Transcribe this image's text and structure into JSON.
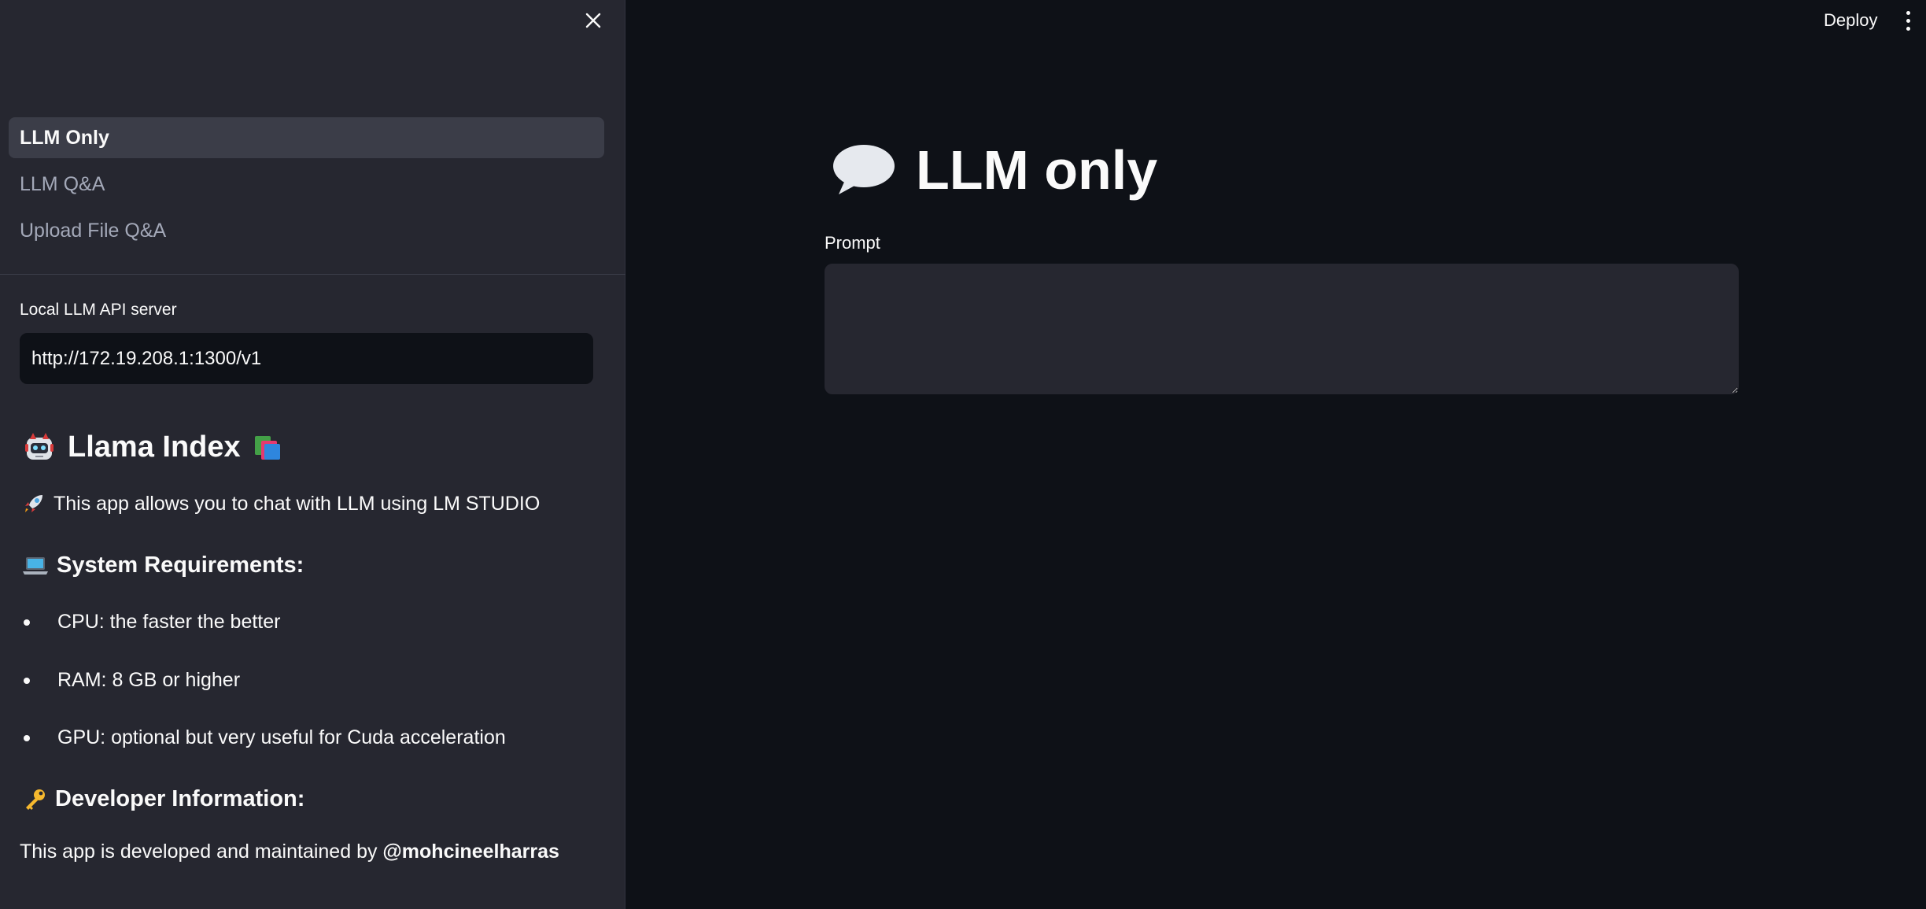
{
  "header": {
    "deploy_label": "Deploy"
  },
  "sidebar": {
    "nav": [
      {
        "label": "LLM Only",
        "active": true
      },
      {
        "label": "LLM Q&A",
        "active": false
      },
      {
        "label": "Upload File Q&A",
        "active": false
      }
    ],
    "server_field": {
      "label": "Local LLM API server",
      "value": "http://172.19.208.1:1300/v1"
    },
    "heading": "Llama Index",
    "description": "This app allows you to chat with LLM using LM STUDIO",
    "requirements_heading": "System Requirements:",
    "requirements": [
      "CPU: the faster the better",
      "RAM: 8 GB or higher",
      "GPU: optional but very useful for Cuda acceleration"
    ],
    "developer_heading": "Developer Information:",
    "developer_text": "This app is developed and maintained by",
    "developer_handle": "@mohcineelharras"
  },
  "main": {
    "title": "LLM only",
    "prompt_label": "Prompt",
    "prompt_value": ""
  },
  "colors": {
    "background": "#0e1117",
    "sidebar": "#262730",
    "nav_active": "#3b3d48",
    "text": "#fafafa",
    "muted_text": "#a3a8b8"
  }
}
